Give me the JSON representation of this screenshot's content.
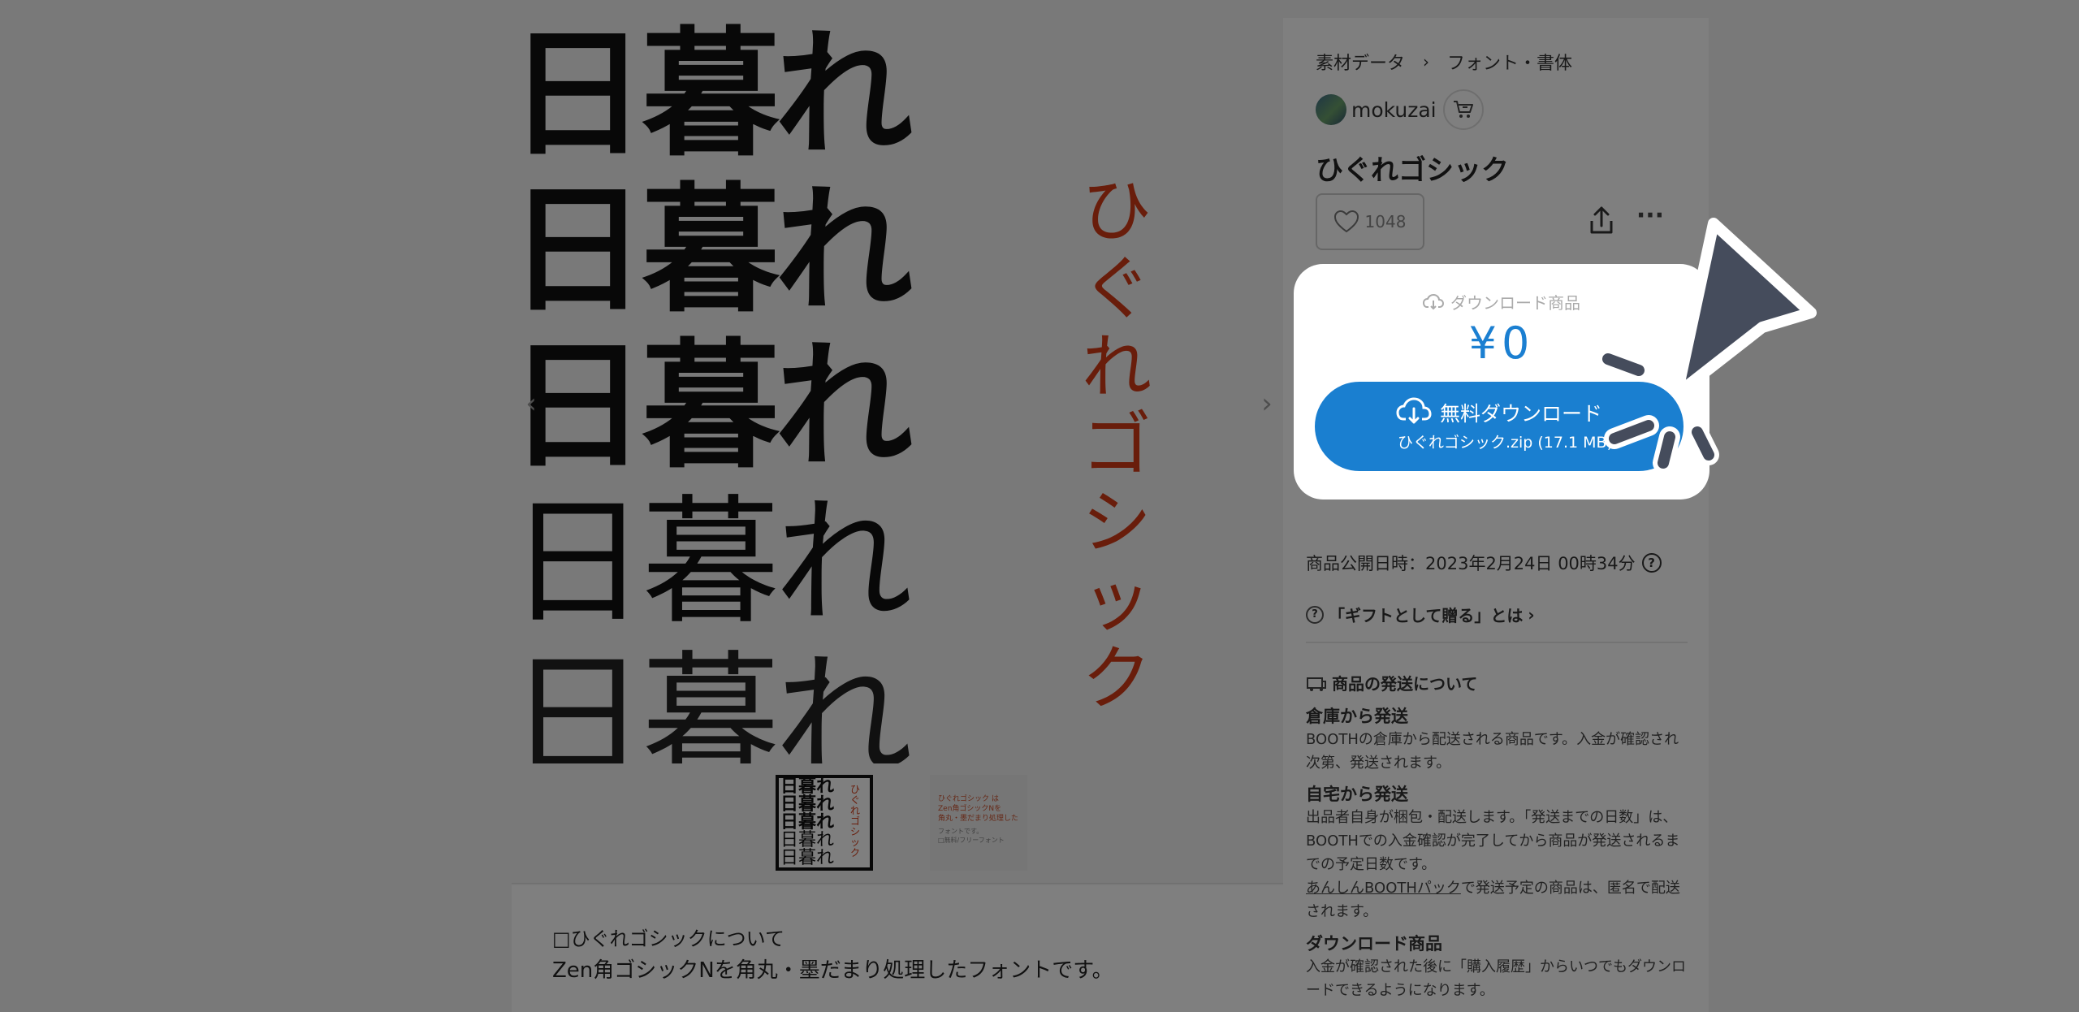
{
  "gallery": {
    "sample_rows": [
      "日暮れ",
      "日暮れ",
      "日暮れ",
      "日暮れ",
      "日暮れ"
    ],
    "vertical_title_chars": [
      "ひ",
      "ぐ",
      "れ",
      "ゴ",
      "シ",
      "ッ",
      "ク"
    ],
    "prev_arrow": "‹",
    "next_arrow": "›",
    "thumb1_rows": [
      "日暮れ",
      "日暮れ",
      "日暮れ",
      "日暮れ",
      "日暮れ"
    ],
    "thumb1_vertical": "ひぐれゴシック",
    "thumb2_title": "ひぐれゴシック は\nZen角ゴシックNを\n角丸・墨だまり処理した",
    "thumb2_sub": "フォントです。\n□無料/フリーフォント"
  },
  "description": {
    "heading": "□ひぐれゴシックについて",
    "body": "Zen角ゴシックNを角丸・墨だまり処理したフォントです。"
  },
  "panel": {
    "breadcrumb": [
      "素材データ",
      "フォント・書体"
    ],
    "breadcrumb_sep": "›",
    "shop_name": "mokuzai",
    "item_title": "ひぐれゴシック",
    "like_count": "1048",
    "more": "···",
    "meta_date": "商品公開日時：2023年2月24日 00時34分",
    "help": "?",
    "gift_link": "「ギフトとして贈る」とは",
    "gift_q": "?",
    "ship_heading": "商品の発送について",
    "ship_warehouse_title": "倉庫から発送",
    "ship_warehouse_body": "BOOTHの倉庫から配送される商品です。入金が確認され次第、発送されます。",
    "ship_home_title": "自宅から発送",
    "ship_home_body": "出品者自身が梱包・配送します。「発送までの日数」は、BOOTHでの入金確認が完了してから商品が発送されるまでの予定日数です。",
    "ship_pack_link": "あんしんBOOTHパック",
    "ship_pack_body": "で発送予定の商品は、匿名で配送されます。",
    "ship_dl_title": "ダウンロード商品",
    "ship_dl_body": "入金が確認された後に「購入履歴」からいつでもダウンロードできるようになります。"
  },
  "purchase": {
    "type_label": "ダウンロード商品",
    "price": "¥0",
    "button_label": "無料ダウンロード",
    "file_info": "ひぐれゴシック.zip (17.1 MB)"
  },
  "colors": {
    "accent": "#1a7fd0",
    "title_red": "#d23a16",
    "overlay": "rgba(0,0,0,0.5)",
    "cursor": "#454c5c"
  }
}
